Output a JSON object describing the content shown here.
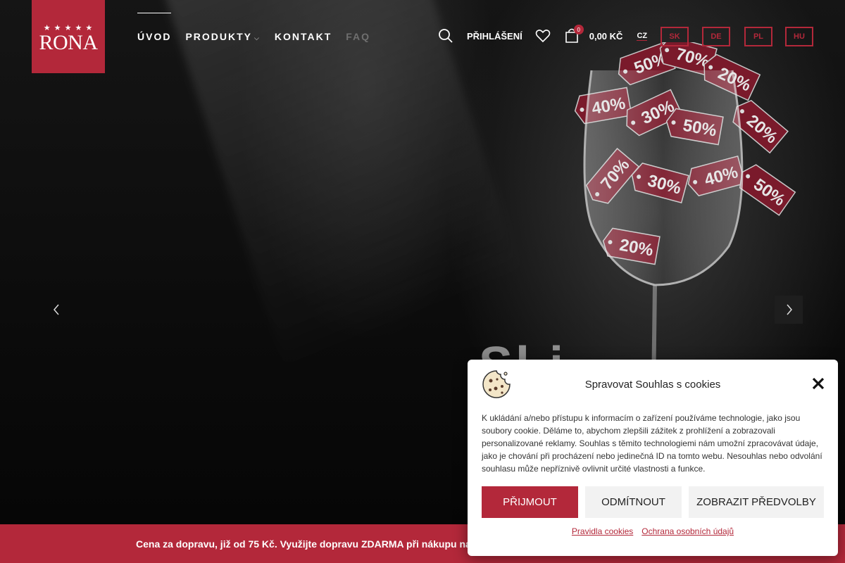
{
  "brand": {
    "logo_text": "RONA",
    "logo_stars": "★ ★ ★ ★ ★"
  },
  "nav": {
    "items": [
      {
        "label": "ÚVOD",
        "active": true
      },
      {
        "label": "PRODUKTY",
        "has_dropdown": true
      },
      {
        "label": "KONTAKT"
      },
      {
        "label": "FAQ",
        "muted": true
      }
    ]
  },
  "header": {
    "login_label": "PŘIHLÁŠENÍ",
    "cart_count": "0",
    "cart_total": "0,00 KČ",
    "current_lang": "CZ",
    "languages": [
      "SK",
      "DE",
      "PL",
      "HU"
    ]
  },
  "hero": {
    "partial_text": "Sl   i",
    "tag_labels": [
      "50%",
      "70%",
      "20%",
      "40%",
      "30%",
      "50%",
      "20%",
      "70%",
      "30%",
      "40%",
      "50%",
      "20%"
    ]
  },
  "shipping_bar": {
    "text": "Cena za dopravu, již od 75 Kč. Využijte dopravu ZDARMA při nákupu na"
  },
  "cookie_modal": {
    "title": "Spravovat Souhlas s cookies",
    "body": "K ukládání a/nebo přístupu k informacím o zařízení používáme technologie, jako jsou soubory cookie. Děláme to, abychom zlepšili zážitek z prohlížení a zobrazovali personalizované reklamy. Souhlas s těmito technologiemi nám umožní zpracovávat údaje, jako je chování při procházení nebo jedinečná ID na tomto webu. Nesouhlas nebo odvolání souhlasu může nepříznivě ovlivnit určité vlastnosti a funkce.",
    "accept_label": "PŘIJMOUT",
    "deny_label": "ODMÍTNOUT",
    "prefs_label": "ZOBRAZIT PŘEDVOLBY",
    "link_cookies": "Pravidla cookies",
    "link_privacy": "Ochrana osobních údajů"
  },
  "colors": {
    "accent": "#b3283a",
    "tag": "#7a1a2b"
  }
}
